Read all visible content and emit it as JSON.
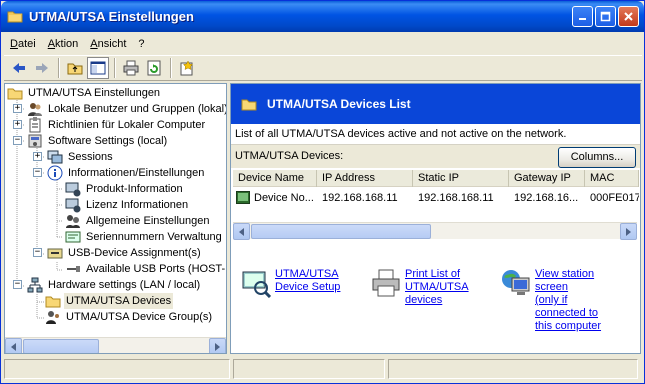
{
  "window": {
    "title": "UTMA/UTSA Einstellungen"
  },
  "menu": [
    "Datei",
    "Aktion",
    "Ansicht",
    "?"
  ],
  "toolbar": {
    "icons": [
      "back-arrow-icon",
      "forward-arrow-icon",
      "up-folder-icon",
      "show-hide-tree-icon",
      "print-icon",
      "refresh-icon",
      "help-icon"
    ]
  },
  "tree": {
    "items": [
      {
        "label": "UTMA/UTSA Einstellungen",
        "icon": "folder-icon"
      },
      {
        "label": "Lokale Benutzer und Gruppen (lokal)",
        "icon": "users-icon"
      },
      {
        "label": "Richtlinien für Lokaler Computer",
        "icon": "policy-icon"
      },
      {
        "label": "Software Settings (local)",
        "icon": "software-icon"
      },
      {
        "label": "Sessions",
        "icon": "sessions-icon"
      },
      {
        "label": "Informationen/Einstellungen",
        "icon": "info-icon"
      },
      {
        "label": "Produkt-Information",
        "icon": "product-info-icon"
      },
      {
        "label": "Lizenz Informationen",
        "icon": "license-icon"
      },
      {
        "label": "Allgemeine Einstellungen",
        "icon": "settings-icon"
      },
      {
        "label": "Seriennummern Verwaltung",
        "icon": "serial-number-icon"
      },
      {
        "label": "USB-Device Assignment(s)",
        "icon": "usb-icon"
      },
      {
        "label": "Available USB Ports (HOST-P",
        "icon": "usb-port-icon"
      },
      {
        "label": "Hardware settings (LAN / local)",
        "icon": "network-icon"
      },
      {
        "label": "UTMA/UTSA Devices",
        "icon": "folder-icon"
      },
      {
        "label": "UTMA/UTSA Device Group(s)",
        "icon": "device-group-icon"
      }
    ]
  },
  "list": {
    "header_title": "UTMA/UTSA Devices List",
    "description": "List of all UTMA/UTSA devices active and not active on the network.",
    "devices_label": "UTMA/UTSA Devices:",
    "columns_button": "Columns...",
    "columns": [
      "Device Name",
      "IP Address",
      "Static IP",
      "Gateway IP",
      "MAC"
    ],
    "rows": [
      [
        "Device No...",
        "192.168.168.11",
        "192.168.168.11",
        "192.168.16...",
        "000FE017"
      ]
    ]
  },
  "tasks": [
    {
      "label_lines": [
        "UTMA/UTSA",
        "Device Setup"
      ],
      "icon": "device-setup-icon"
    },
    {
      "label_lines": [
        "Print List of",
        "UTMA/UTSA",
        "devices"
      ],
      "icon": "printer-icon"
    },
    {
      "label_lines": [
        "View station",
        "screen",
        "(only if",
        "connected to",
        "this computer"
      ],
      "icon": "monitor-icon"
    }
  ],
  "colors": {
    "title_bar": "#0054e3",
    "list_header": "#0a46d8",
    "link": "#0000ee",
    "selection": "#ece9d8"
  }
}
